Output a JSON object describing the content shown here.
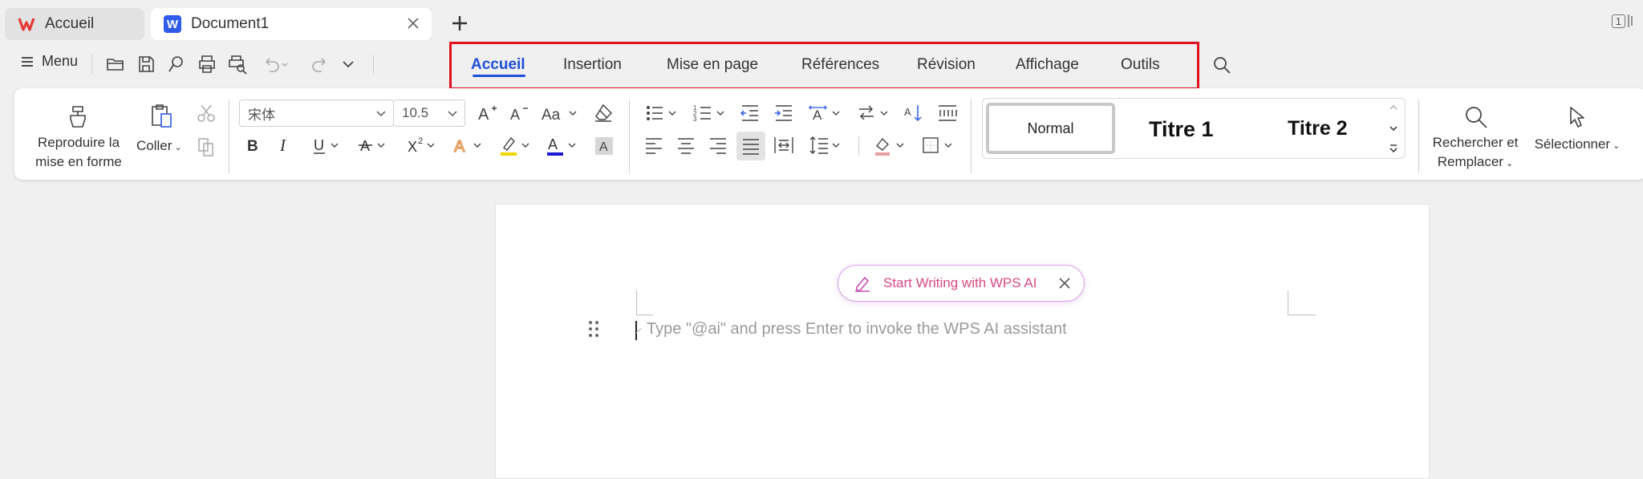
{
  "titlebar": {
    "tabs": [
      {
        "label": "Accueil",
        "icon": "wps-logo-icon"
      },
      {
        "label": "Document1",
        "icon": "word-doc-icon"
      }
    ],
    "new_tab_icon": "plus-icon",
    "page_count": "1"
  },
  "quickbar": {
    "menu_label": "Menu",
    "icons": [
      "open-folder-icon",
      "save-icon",
      "export-icon",
      "print-icon",
      "print-preview-icon",
      "undo-icon",
      "redo-icon",
      "more-chevron-icon"
    ]
  },
  "menutabs": [
    {
      "label": "Accueil",
      "active": true
    },
    {
      "label": "Insertion"
    },
    {
      "label": "Mise en page"
    },
    {
      "label": "Références"
    },
    {
      "label": "Révision"
    },
    {
      "label": "Affichage"
    },
    {
      "label": "Outils"
    }
  ],
  "ribbon": {
    "format_painter_label_1": "Reproduire la",
    "format_painter_label_2": "mise en forme",
    "paste_label": "Coller",
    "font_name": "宋体",
    "font_size": "10.5",
    "styles": {
      "normal": "Normal",
      "title1": "Titre 1",
      "title2": "Titre 2"
    },
    "find_label_1": "Rechercher et",
    "find_label_2": "Remplacer",
    "select_label": "Sélectionner"
  },
  "document": {
    "ai_button_label": "Start Writing with WPS AI",
    "placeholder": "Type \"@ai\" and press Enter to invoke the WPS AI assistant"
  },
  "colors": {
    "accent": "#1d4fd8",
    "highlight_box": "#e0101c",
    "ai_pink": "#d9497f",
    "font_color_underline": "#1a1ad6",
    "highlighter_yellow": "#f2d600"
  }
}
